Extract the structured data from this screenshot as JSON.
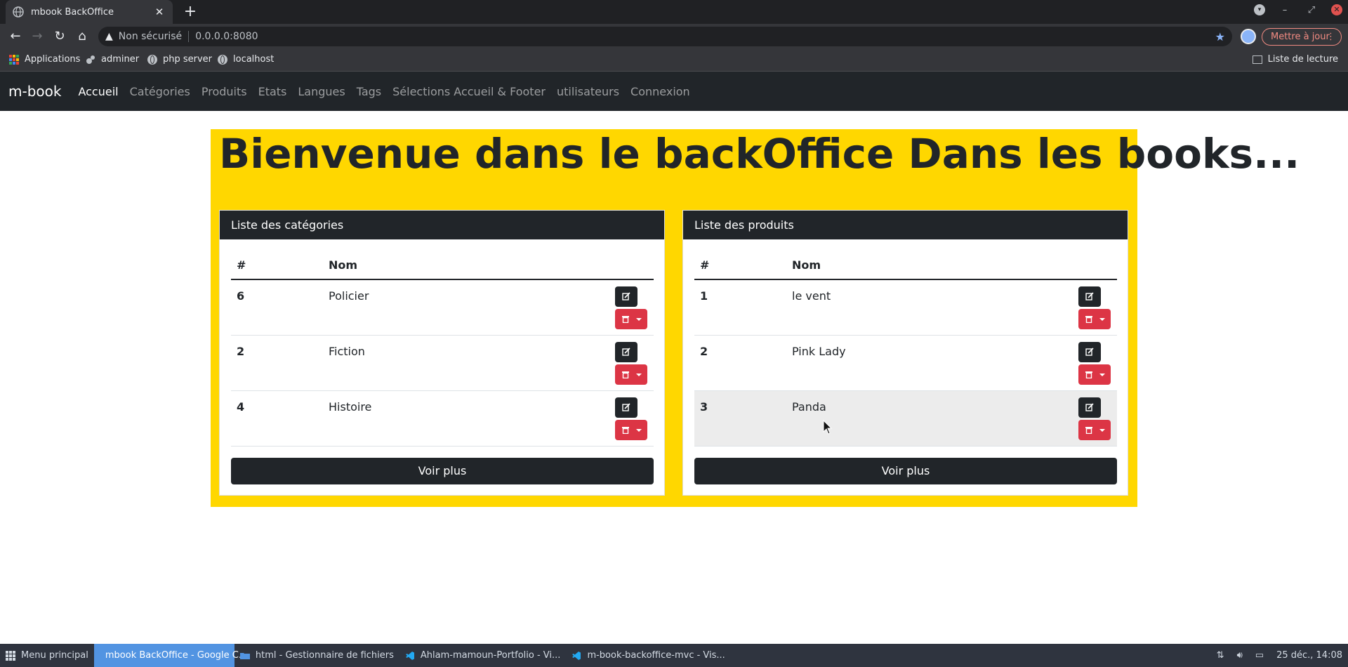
{
  "browser": {
    "tab_title": "mbook BackOffice",
    "tab_close": "✕",
    "new_tab": "+",
    "security_label": "Non sécurisé",
    "url": "0.0.0.0:8080",
    "update_button": "Mettre à jour",
    "bookmarks": [
      {
        "label": "Applications",
        "icon": "apps-grid-icon"
      },
      {
        "label": "adminer",
        "icon": "adminer-icon"
      },
      {
        "label": "php server",
        "icon": "globe-icon"
      },
      {
        "label": "localhost",
        "icon": "globe-icon"
      }
    ],
    "reading_list": "Liste de lecture"
  },
  "navbar": {
    "brand": "m-book",
    "links": [
      "Accueil",
      "Catégories",
      "Produits",
      "Etats",
      "Langues",
      "Tags",
      "Sélections Accueil & Footer",
      "utilisateurs",
      "Connexion"
    ],
    "active": "Accueil"
  },
  "main": {
    "title": "Bienvenue dans le backOffice Dans les books...",
    "bg_color": "#ffd700",
    "categories": {
      "header": "Liste des catégories",
      "col_id": "#",
      "col_name": "Nom",
      "rows": [
        {
          "id": "6",
          "name": "Policier"
        },
        {
          "id": "2",
          "name": "Fiction"
        },
        {
          "id": "4",
          "name": "Histoire"
        }
      ],
      "more": "Voir plus"
    },
    "products": {
      "header": "Liste des produits",
      "col_id": "#",
      "col_name": "Nom",
      "rows": [
        {
          "id": "1",
          "name": "le vent"
        },
        {
          "id": "2",
          "name": "Pink Lady"
        },
        {
          "id": "3",
          "name": "Panda"
        }
      ],
      "more": "Voir plus"
    }
  },
  "taskbar": {
    "menu": "Menu principal",
    "items": [
      "mbook BackOffice - Google C...",
      "html - Gestionnaire de fichiers",
      "Ahlam-mamoun-Portfolio - Vi...",
      "m-book-backoffice-mvc - Vis..."
    ],
    "clock": "25 déc., 14:08"
  },
  "colors": {
    "dark": "#212529",
    "danger": "#dc3545",
    "yellow": "#ffd700",
    "taskbar": "#2f343f",
    "taskbar_active": "#5294e2"
  }
}
